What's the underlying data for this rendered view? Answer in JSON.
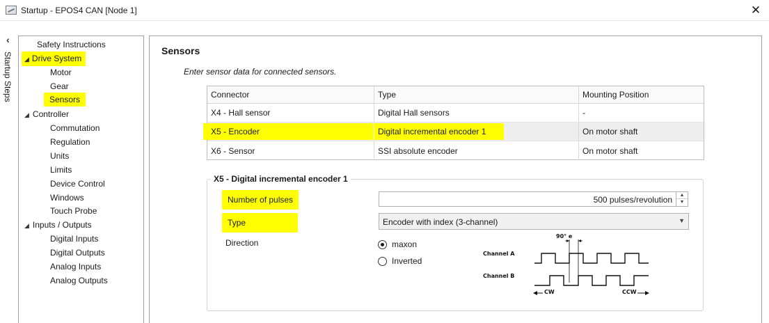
{
  "window": {
    "title": "Startup - EPOS4 CAN [Node 1]",
    "close_glyph": "✕"
  },
  "rail": {
    "chevron": "‹",
    "label": "Startup Steps"
  },
  "nav": {
    "items": [
      {
        "label": "Safety Instructions"
      },
      {
        "label": "Drive System",
        "expanded": true,
        "highlighted": true
      },
      {
        "label": "Motor"
      },
      {
        "label": "Gear"
      },
      {
        "label": "Sensors",
        "highlighted": true,
        "selected": true
      },
      {
        "label": "Controller",
        "expanded": true
      },
      {
        "label": "Commutation"
      },
      {
        "label": "Regulation"
      },
      {
        "label": "Units"
      },
      {
        "label": "Limits"
      },
      {
        "label": "Device Control"
      },
      {
        "label": "Windows"
      },
      {
        "label": "Touch Probe"
      },
      {
        "label": "Inputs / Outputs",
        "expanded": true
      },
      {
        "label": "Digital Inputs"
      },
      {
        "label": "Digital Outputs"
      },
      {
        "label": "Analog Inputs"
      },
      {
        "label": "Analog Outputs"
      }
    ],
    "expand_glyph": "◢"
  },
  "main": {
    "title": "Sensors",
    "subtitle": "Enter sensor data for connected sensors.",
    "table": {
      "headers": [
        "Connector",
        "Type",
        "Mounting Position"
      ],
      "rows": [
        {
          "connector": "X4 - Hall sensor",
          "type": "Digital Hall sensors",
          "mounting": "-"
        },
        {
          "connector": "X5 - Encoder",
          "type": "Digital incremental encoder 1",
          "mounting": "On motor shaft",
          "selected": true,
          "highlighted": true
        },
        {
          "connector": "X6 - Sensor",
          "type": "SSI absolute encoder",
          "mounting": "On motor shaft"
        }
      ]
    },
    "detail": {
      "group_title": "X5 - Digital incremental encoder 1",
      "pulses_label": "Number of pulses",
      "pulses_value": "500 pulses/revolution",
      "type_label": "Type",
      "type_value": "Encoder with index (3-channel)",
      "direction_label": "Direction",
      "direction_options": [
        {
          "label": "maxon",
          "checked": true
        },
        {
          "label": "Inverted",
          "checked": false
        }
      ],
      "diagram": {
        "phase_label": "90° e",
        "channel_a": "Channel A",
        "channel_b": "Channel B",
        "cw": "CW",
        "ccw": "CCW"
      }
    }
  },
  "colors": {
    "highlight": "#ffff00",
    "border": "#a0a0a0",
    "selected_row": "#eeeeee"
  }
}
